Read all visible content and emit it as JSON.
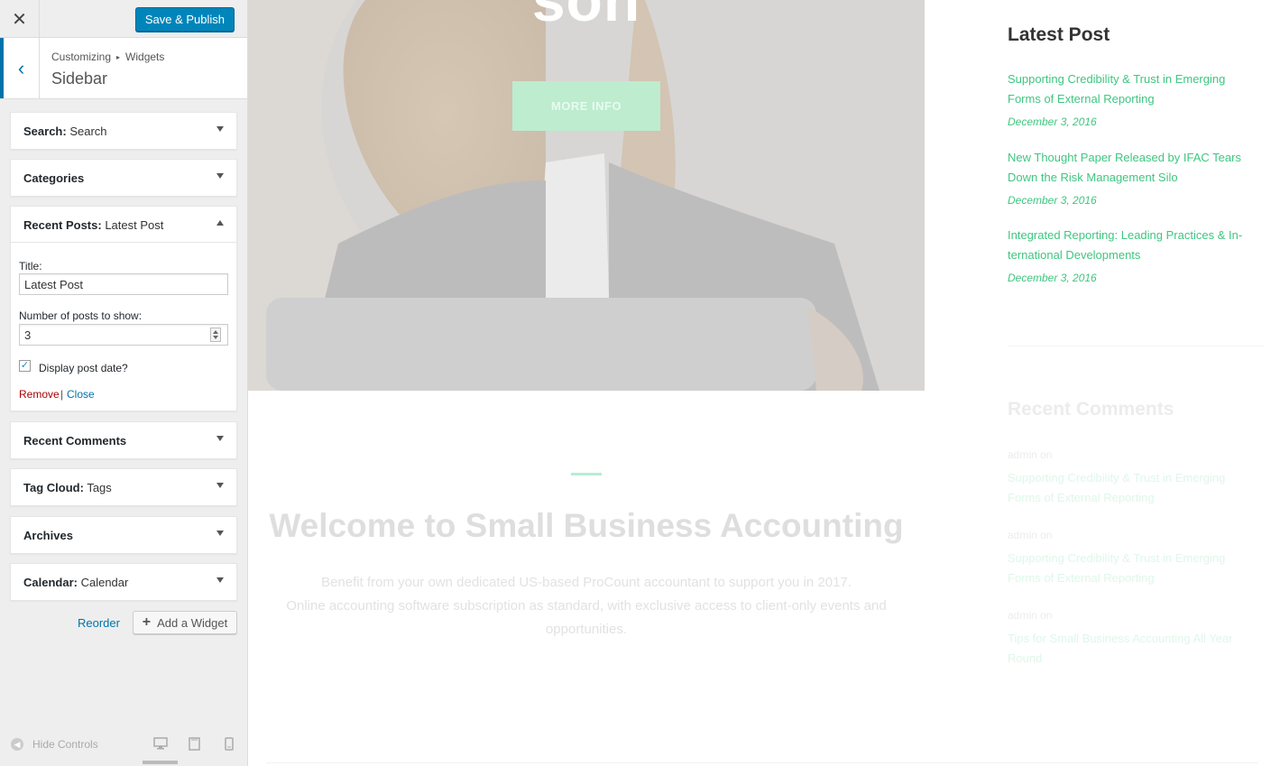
{
  "customizer": {
    "close_icon": "close-icon",
    "publish_label": "Save & Publish",
    "breadcrumb": {
      "root": "Customizing",
      "separator": "▸",
      "current": "Widgets"
    },
    "section_title": "Sidebar",
    "widgets": [
      {
        "name": "Search:",
        "subtitle": "Search"
      },
      {
        "name": "Categories",
        "subtitle": ""
      },
      {
        "name": "Recent Posts:",
        "subtitle": "Latest Post"
      },
      {
        "name": "Recent Comments",
        "subtitle": ""
      },
      {
        "name": "Tag Cloud:",
        "subtitle": "Tags"
      },
      {
        "name": "Archives",
        "subtitle": ""
      },
      {
        "name": "Calendar:",
        "subtitle": "Calendar"
      }
    ],
    "recent_posts_form": {
      "title_label": "Title:",
      "title_value": "Latest Post",
      "count_label": "Number of posts to show:",
      "count_value": "3",
      "show_date_label": "Display post date?",
      "show_date_checked": true,
      "remove_label": "Remove",
      "separator": "|",
      "close_label": "Close"
    },
    "reorder_label": "Reorder",
    "add_widget_label": "Add a Widget",
    "hide_controls_label": "Hide Controls",
    "accent_color": "#0073aa",
    "publish_color": "#0085ba"
  },
  "preview": {
    "hero_title": "son",
    "more_info_label": "MORE INFO",
    "welcome_title": "Welcome to Small Business Accounting",
    "welcome_lines": [
      "Benefit from your own dedicated US-based ProCount accountant to support you in 2017.",
      "Online accounting software subscription as standard, with exclusive access to client-only events and opportunities."
    ],
    "latest_post_heading": "Latest Post",
    "latest_posts": [
      {
        "title_lines": [
          "Supporting Credibility & Trust in Emerging",
          "Forms of External Reporting"
        ],
        "date": "December 3, 2016"
      },
      {
        "title_lines": [
          "New Thought Paper Released by IFAC Tears",
          "Down the Risk Management Silo"
        ],
        "date": "December 3, 2016"
      },
      {
        "title_lines": [
          "Integrated Reporting: Leading Practices & In-",
          "ternational Developments"
        ],
        "date": "December 3, 2016"
      }
    ],
    "recent_comments_heading": "Recent Comments",
    "recent_comments": [
      {
        "meta": "admin  on",
        "title_lines": [
          "Supporting Credibility & Trust in Emerging",
          "Forms of External Reporting"
        ]
      },
      {
        "meta": "admin  on",
        "title_lines": [
          "Supporting Credibility & Trust in Emerging",
          "Forms of External Reporting"
        ]
      },
      {
        "meta": "admin  on",
        "title_lines": [
          "Tips for Small Business Accounting All Year",
          "Round"
        ]
      }
    ],
    "link_color": "#3fc681"
  }
}
